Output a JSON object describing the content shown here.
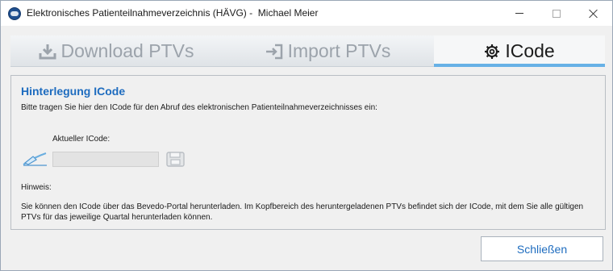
{
  "window": {
    "title": "Elektronisches Patienteilnahmeverzeichnis (HÄVG) -  Michael Meier"
  },
  "tabs": [
    {
      "label": "Download PTVs",
      "icon": "download-icon",
      "active": false
    },
    {
      "label": "Import PTVs",
      "icon": "import-icon",
      "active": false
    },
    {
      "label": "ICode",
      "icon": "gear-icon",
      "active": true
    }
  ],
  "panel": {
    "heading": "Hinterlegung ICode",
    "intro": "Bitte tragen Sie hier den ICode für den Abruf des elektronischen Patienteilnahmeverzeichnisses ein:",
    "field_label": "Aktueller ICode:",
    "field_value": "",
    "hint_label": "Hinweis:",
    "hint_text": "Sie können den ICode über das Bevedo-Portal herunterladen. Im Kopfbereich des heruntergeladenen PTVs befindet sich der ICode, mit dem Sie alle gültigen PTVs für das jeweilige Quartal herunterladen können."
  },
  "footer": {
    "close_label": "Schließen"
  },
  "colors": {
    "accent": "#1e6cbf",
    "tab_underline": "#67b1e6",
    "inactive_tab_text": "#9ca3ab"
  }
}
